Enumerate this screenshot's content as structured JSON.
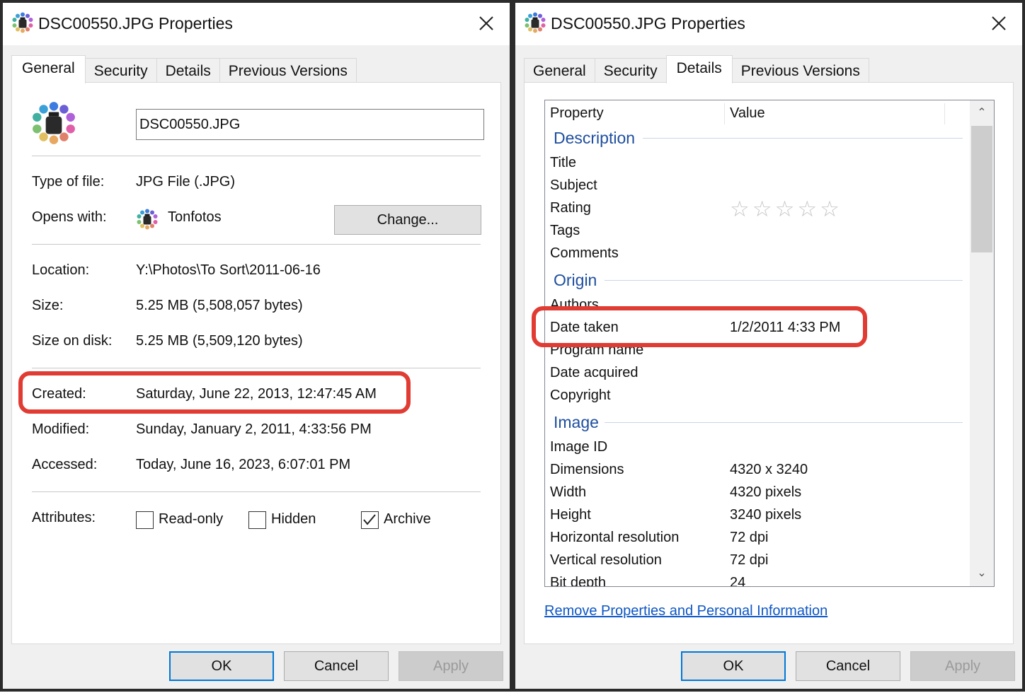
{
  "left_window": {
    "title": "DSC00550.JPG Properties",
    "tabs": [
      "General",
      "Security",
      "Details",
      "Previous Versions"
    ],
    "active_tab": "General",
    "file_name": "DSC00550.JPG",
    "type_label": "Type of file:",
    "type_value": "JPG File (.JPG)",
    "opens_label": "Opens with:",
    "opens_value": "Tonfotos",
    "change_button": "Change...",
    "location_label": "Location:",
    "location_value": "Y:\\Photos\\To Sort\\2011-06-16",
    "size_label": "Size:",
    "size_value": "5.25 MB (5,508,057 bytes)",
    "size_on_disk_label": "Size on disk:",
    "size_on_disk_value": "5.25 MB (5,509,120 bytes)",
    "created_label": "Created:",
    "created_value": "Saturday, June 22, 2013, 12:47:45 AM",
    "modified_label": "Modified:",
    "modified_value": "Sunday, January 2, 2011, 4:33:56 PM",
    "accessed_label": "Accessed:",
    "accessed_value": "Today, June 16, 2023, 6:07:01 PM",
    "attributes_label": "Attributes:",
    "attributes": [
      {
        "label": "Read-only",
        "checked": false
      },
      {
        "label": "Hidden",
        "checked": false
      },
      {
        "label": "Archive",
        "checked": true
      }
    ],
    "buttons": {
      "ok": "OK",
      "cancel": "Cancel",
      "apply": "Apply"
    }
  },
  "right_window": {
    "title": "DSC00550.JPG Properties",
    "tabs": [
      "General",
      "Security",
      "Details",
      "Previous Versions"
    ],
    "active_tab": "Details",
    "columns": {
      "property": "Property",
      "value": "Value"
    },
    "sections": {
      "description": "Description",
      "origin": "Origin",
      "image": "Image"
    },
    "description_props": [
      {
        "name": "Title",
        "value": ""
      },
      {
        "name": "Subject",
        "value": ""
      },
      {
        "name": "Rating",
        "value": ""
      },
      {
        "name": "Tags",
        "value": ""
      },
      {
        "name": "Comments",
        "value": ""
      }
    ],
    "rating_stars": 0,
    "rating_max": 5,
    "origin_props": [
      {
        "name": "Authors",
        "value": ""
      },
      {
        "name": "Date taken",
        "value": "1/2/2011 4:33 PM"
      },
      {
        "name": "Program name",
        "value": ""
      },
      {
        "name": "Date acquired",
        "value": ""
      },
      {
        "name": "Copyright",
        "value": ""
      }
    ],
    "image_props": [
      {
        "name": "Image ID",
        "value": ""
      },
      {
        "name": "Dimensions",
        "value": "4320 x 3240"
      },
      {
        "name": "Width",
        "value": "4320 pixels"
      },
      {
        "name": "Height",
        "value": "3240 pixels"
      },
      {
        "name": "Horizontal resolution",
        "value": "72 dpi"
      },
      {
        "name": "Vertical resolution",
        "value": "72 dpi"
      },
      {
        "name": "Bit depth",
        "value": "24"
      }
    ],
    "remove_link": "Remove Properties and Personal Information",
    "buttons": {
      "ok": "OK",
      "cancel": "Cancel",
      "apply": "Apply"
    }
  },
  "colors": {
    "highlight": "#e03c33",
    "section_heading": "#1e4e9f",
    "link": "#0d56c4",
    "focus_border": "#0078d7"
  }
}
